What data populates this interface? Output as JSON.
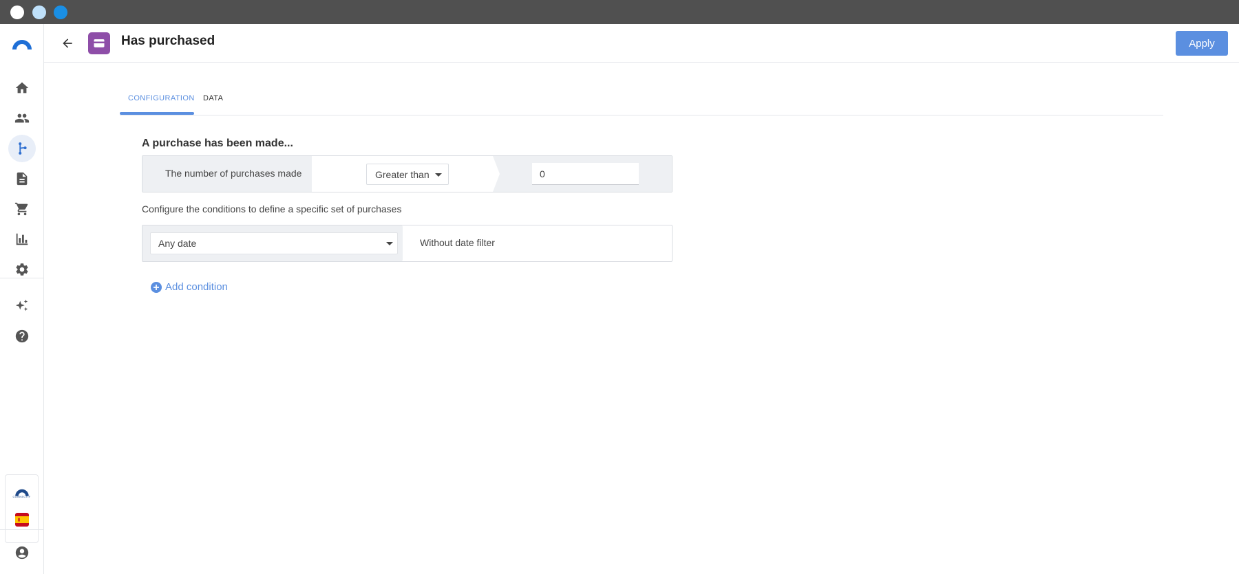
{
  "header": {
    "title": "Has purchased",
    "apply_label": "Apply",
    "entity_icon": "card-icon"
  },
  "sidebar": {
    "items": [
      {
        "name": "home-icon",
        "active": false
      },
      {
        "name": "users-icon",
        "active": false
      },
      {
        "name": "workflow-icon",
        "active": true
      },
      {
        "name": "document-icon",
        "active": false
      },
      {
        "name": "cart-icon",
        "active": false
      },
      {
        "name": "bar-chart-icon",
        "active": false
      },
      {
        "name": "gear-icon",
        "active": false
      },
      {
        "name": "sparkles-icon",
        "active": false
      },
      {
        "name": "help-icon",
        "active": false
      }
    ],
    "brand_text": "CONNECTIF",
    "language_flag": "spain-flag-icon"
  },
  "tabs": [
    {
      "label": "CONFIGURATION",
      "active": true
    },
    {
      "label": "DATA",
      "active": false
    }
  ],
  "main": {
    "section_title": "A purchase has been made...",
    "condition": {
      "label": "The number of purchases made",
      "operator": "Greater than",
      "value": "0"
    },
    "helper_text": "Configure the conditions to define a specific set of purchases",
    "date_filter": {
      "selected": "Any date",
      "description": "Without date filter"
    },
    "add_condition_label": "Add condition"
  },
  "colors": {
    "accent": "#5b8fe0",
    "entity_icon_bg": "#8e4ea8",
    "titlebar": "#505050"
  }
}
